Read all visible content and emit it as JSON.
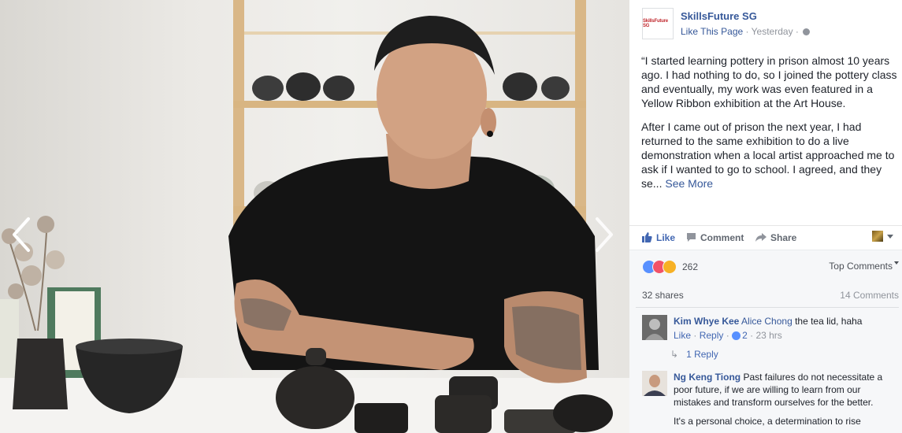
{
  "page": {
    "name": "SkillsFuture SG",
    "logo_text": "SkillsFuture SG",
    "like_page": "Like This Page",
    "timestamp": "Yesterday",
    "separator": "·"
  },
  "post": {
    "paragraph1": "“I started learning pottery in prison almost 10 years ago. I had nothing to do, so I joined the pottery class and eventually, my work was even featured in a Yellow Ribbon exhibition at the Art House.",
    "paragraph2": "After I came out of prison the next year, I had returned to the same exhibition to do a live demonstration when a local artist approached me to ask if I wanted to go to school. I agreed, and they se...",
    "see_more": "See More"
  },
  "actions": {
    "like": "Like",
    "comment": "Comment",
    "share": "Share"
  },
  "stats": {
    "reaction_count": "262",
    "top_comments": "Top Comments",
    "shares": "32 shares",
    "comments": "14 Comments"
  },
  "comments": [
    {
      "author": "Kim Whye Kee",
      "mention": "Alice Chong",
      "text": " the tea lid, haha",
      "like": "Like",
      "reply": "Reply",
      "sep": "·",
      "like_count": "2",
      "time": "23 hrs",
      "replies": "1 Reply"
    },
    {
      "author": "Ng Keng Tiong",
      "text": " Past failures do not necessitate a poor future, if we are willing to learn from our mistakes and transform ourselves for the better.",
      "text2": "It's a personal choice, a determination to rise"
    }
  ],
  "colors": {
    "link": "#365899",
    "accent": "#4267b2",
    "panel_bg": "#f6f7f9",
    "muted": "#90949c"
  },
  "icons": {
    "prev": "chevron-left-icon",
    "next": "chevron-right-icon",
    "like": "thumbs-up-icon",
    "comment": "speech-bubble-icon",
    "share": "share-arrow-icon",
    "globe": "globe-icon"
  }
}
